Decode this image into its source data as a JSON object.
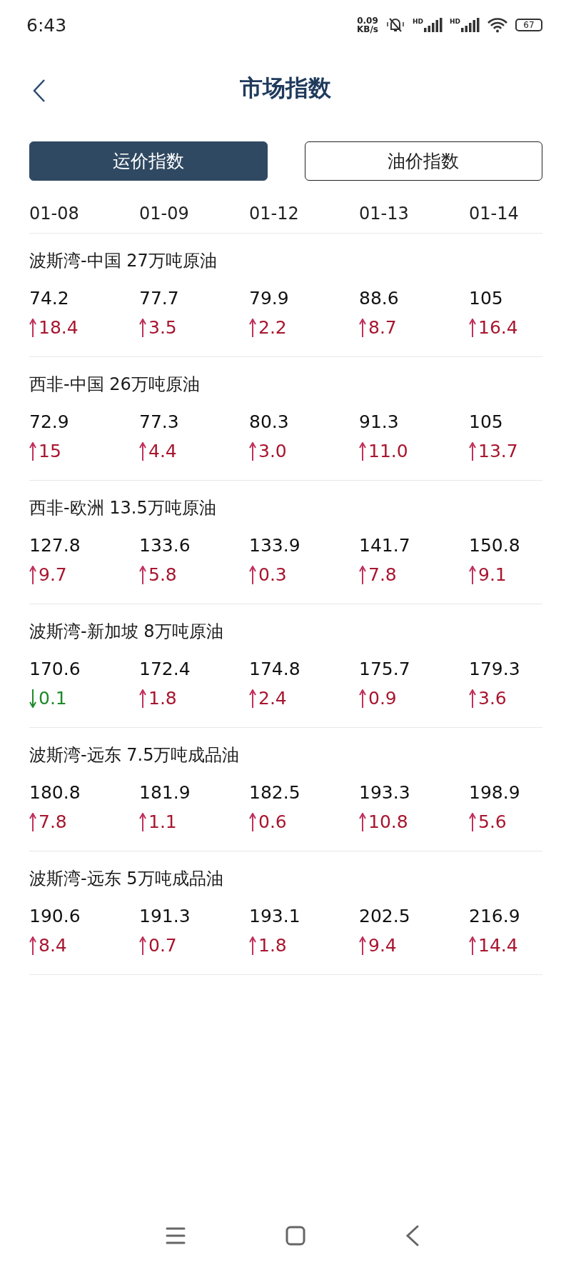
{
  "status_bar": {
    "time": "6:43",
    "net_speed": "0.09",
    "net_unit": "KB/s",
    "signal_label_1": "HD",
    "signal_label_2": "HD",
    "battery": "67"
  },
  "header": {
    "title": "市场指数"
  },
  "tabs": [
    {
      "label": "运价指数",
      "selected": true
    },
    {
      "label": "油价指数",
      "selected": false
    }
  ],
  "dates": [
    "01-08",
    "01-09",
    "01-12",
    "01-13",
    "01-14"
  ],
  "routes": [
    {
      "name": "波斯湾-中国 27万吨原油",
      "cells": [
        {
          "value": "74.2",
          "change": "18.4",
          "kind": "up"
        },
        {
          "value": "77.7",
          "change": "3.5",
          "kind": "up"
        },
        {
          "value": "79.9",
          "change": "2.2",
          "kind": "up"
        },
        {
          "value": "88.6",
          "change": "8.7",
          "kind": "up"
        },
        {
          "value": "105",
          "change": "16.4",
          "kind": "up"
        }
      ]
    },
    {
      "name": "西非-中国 26万吨原油",
      "cells": [
        {
          "value": "72.9",
          "change": "15",
          "kind": "up"
        },
        {
          "value": "77.3",
          "change": "4.4",
          "kind": "up"
        },
        {
          "value": "80.3",
          "change": "3.0",
          "kind": "up"
        },
        {
          "value": "91.3",
          "change": "11.0",
          "kind": "up"
        },
        {
          "value": "105",
          "change": "13.7",
          "kind": "up"
        }
      ]
    },
    {
      "name": "西非-欧洲 13.5万吨原油",
      "cells": [
        {
          "value": "127.8",
          "change": "9.7",
          "kind": "up"
        },
        {
          "value": "133.6",
          "change": "5.8",
          "kind": "up"
        },
        {
          "value": "133.9",
          "change": "0.3",
          "kind": "up"
        },
        {
          "value": "141.7",
          "change": "7.8",
          "kind": "up"
        },
        {
          "value": "150.8",
          "change": "9.1",
          "kind": "up"
        }
      ]
    },
    {
      "name": "波斯湾-新加坡 8万吨原油",
      "cells": [
        {
          "value": "170.6",
          "change": "0.1",
          "kind": "down"
        },
        {
          "value": "172.4",
          "change": "1.8",
          "kind": "up"
        },
        {
          "value": "174.8",
          "change": "2.4",
          "kind": "up"
        },
        {
          "value": "175.7",
          "change": "0.9",
          "kind": "up"
        },
        {
          "value": "179.3",
          "change": "3.6",
          "kind": "up"
        }
      ]
    },
    {
      "name": "波斯湾-远东 7.5万吨成品油",
      "cells": [
        {
          "value": "180.8",
          "change": "7.8",
          "kind": "up"
        },
        {
          "value": "181.9",
          "change": "1.1",
          "kind": "up"
        },
        {
          "value": "182.5",
          "change": "0.6",
          "kind": "up"
        },
        {
          "value": "193.3",
          "change": "10.8",
          "kind": "up"
        },
        {
          "value": "198.9",
          "change": "5.6",
          "kind": "up"
        }
      ]
    },
    {
      "name": "波斯湾-远东 5万吨成品油",
      "cells": [
        {
          "value": "190.6",
          "change": "8.4",
          "kind": "up"
        },
        {
          "value": "191.3",
          "change": "0.7",
          "kind": "up"
        },
        {
          "value": "193.1",
          "change": "1.8",
          "kind": "up"
        },
        {
          "value": "202.5",
          "change": "9.4",
          "kind": "up"
        },
        {
          "value": "216.9",
          "change": "14.4",
          "kind": "up"
        }
      ]
    }
  ]
}
